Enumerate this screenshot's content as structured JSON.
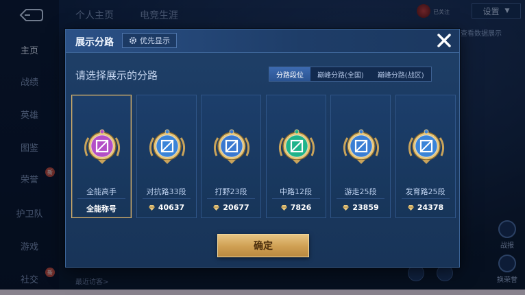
{
  "top": {
    "tabs": [
      "个人主页",
      "电竞生涯"
    ],
    "settings_label": "设置",
    "small_text": "已关注",
    "link_text": "查看数据展示"
  },
  "sidebar": {
    "items": [
      {
        "label": "主页",
        "active": true
      },
      {
        "label": "战绩"
      },
      {
        "label": "英雄"
      },
      {
        "label": "图鉴"
      },
      {
        "label": "荣誉",
        "badge": "新"
      },
      {
        "label": "护卫队"
      },
      {
        "label": "游戏"
      },
      {
        "label": "社交",
        "badge": "新"
      }
    ]
  },
  "bottom": {
    "recent_visitors": "最近访客>"
  },
  "right_buttons": [
    "战报",
    "换荣誉"
  ],
  "modal": {
    "title": "展示分路",
    "priority_label": "优先显示",
    "subtitle": "请选择展示的分路",
    "tabs": [
      {
        "label": "分路段位",
        "active": true
      },
      {
        "label": "巅峰分路(全国)"
      },
      {
        "label": "巅峰分路(战区)"
      }
    ],
    "cards": [
      {
        "name": "全能高手",
        "score": "全能称号",
        "selected": true,
        "emblem": "all-round-emblem-icon",
        "color": "#b34fc7"
      },
      {
        "name": "对抗路33段",
        "score": "40637",
        "emblem": "clash-lane-emblem-icon",
        "color": "#3a84d8"
      },
      {
        "name": "打野23段",
        "score": "20677",
        "emblem": "jungle-emblem-icon",
        "color": "#3a78d0"
      },
      {
        "name": "中路12段",
        "score": "7826",
        "emblem": "mid-lane-emblem-icon",
        "color": "#1fb38a"
      },
      {
        "name": "游走25段",
        "score": "23859",
        "emblem": "roam-emblem-icon",
        "color": "#3a7ed4"
      },
      {
        "name": "发育路25段",
        "score": "24378",
        "emblem": "farm-lane-emblem-icon",
        "color": "#3a84d8"
      }
    ],
    "confirm_label": "确定"
  }
}
